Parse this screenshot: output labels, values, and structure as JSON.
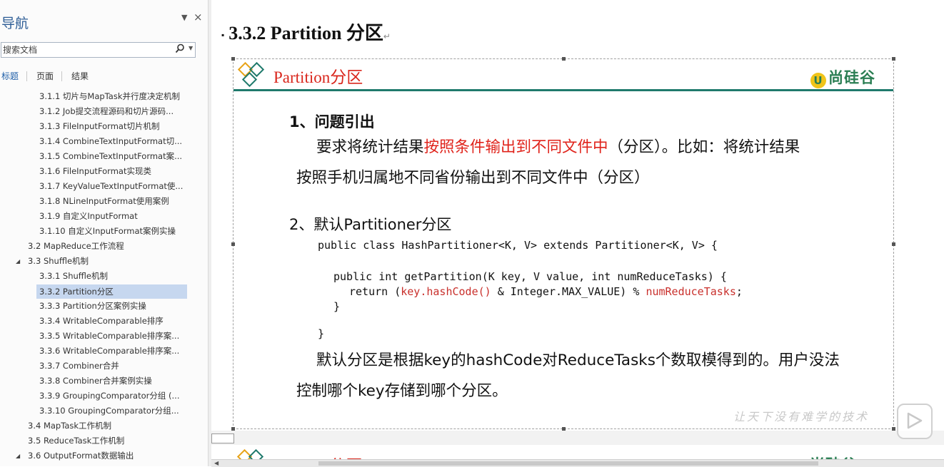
{
  "nav": {
    "title": "导航",
    "dropdown_icon": "▼",
    "close_icon": "×",
    "search_placeholder": "搜索文档",
    "tabs": [
      {
        "label": "标题"
      },
      {
        "label": "页面"
      },
      {
        "label": "结果"
      }
    ],
    "tree": [
      {
        "label": "3.1.1 切片与MapTask并行度决定机制"
      },
      {
        "label": "3.1.2 Job提交流程源码和切片源码..."
      },
      {
        "label": "3.1.3 FileInputFormat切片机制"
      },
      {
        "label": "3.1.4 CombineTextInputFormat切..."
      },
      {
        "label": "3.1.5 CombineTextInputFormat案..."
      },
      {
        "label": "3.1.6 FileInputFormat实现类"
      },
      {
        "label": "3.1.7 KeyValueTextInputFormat使..."
      },
      {
        "label": "3.1.8 NLineInputFormat使用案例"
      },
      {
        "label": "3.1.9 自定义InputFormat"
      },
      {
        "label": "3.1.10 自定义InputFormat案例实操"
      },
      {
        "label": "3.2 MapReduce工作流程"
      },
      {
        "label": "3.3 Shuffle机制"
      },
      {
        "label": "3.3.1 Shuffle机制"
      },
      {
        "label": "3.3.2 Partition分区"
      },
      {
        "label": "3.3.3 Partition分区案例实操"
      },
      {
        "label": "3.3.4 WritableComparable排序"
      },
      {
        "label": "3.3.5 WritableComparable排序案..."
      },
      {
        "label": "3.3.6 WritableComparable排序案..."
      },
      {
        "label": "3.3.7 Combiner合并"
      },
      {
        "label": "3.3.8 Combiner合并案例实操"
      },
      {
        "label": "3.3.9 GroupingComparator分组 (..."
      },
      {
        "label": "3.3.10 GroupingComparator分组..."
      },
      {
        "label": "3.4 MapTask工作机制"
      },
      {
        "label": "3.5 ReduceTask工作机制"
      },
      {
        "label": "3.6 OutputFormat数据输出"
      }
    ]
  },
  "doc": {
    "heading_bullet": "▪",
    "heading": "3.3.2 Partition 分区",
    "heading_mark": "↵",
    "slide": {
      "title": "Partition分区",
      "logo_badge": "U",
      "logo_text": "尚硅谷",
      "section1_title": "1、问题引出",
      "para1_pre": "要求将统计结果",
      "para1_red": "按照条件输出到不同文件中",
      "para1_post": "（分区）。比如：将统计结果",
      "para1_line2": "按照手机归属地不同省份输出到不同文件中（分区）",
      "section2_title": "2、默认Partitioner分区",
      "code_line1": "public class HashPartitioner<K, V> extends Partitioner<K, V> {",
      "code_line2": "public int getPartition(K key, V value, int numReduceTasks) {",
      "code_line3_a": "return (",
      "code_line3_red1": "key.hashCode()",
      "code_line3_b": " & Integer.MAX_VALUE) % ",
      "code_line3_red2": "numReduceTasks",
      "code_line3_c": ";",
      "code_line4": "}",
      "code_line5": "}",
      "para2_line1": "默认分区是根据key的hashCode对ReduceTasks个数取模得到的。用户没法",
      "para2_line2": "控制哪个key存储到哪个分区。",
      "slogan": "让天下没有难学的技术"
    },
    "next_slide_title": "Partition分区",
    "next_slide_logo": "尚硅谷"
  },
  "colors": {
    "red_accent": "#e0231b",
    "teal_rule": "#1f7a6c",
    "nav_selected": "#c6d7ef",
    "nav_title": "#2d5d96"
  }
}
